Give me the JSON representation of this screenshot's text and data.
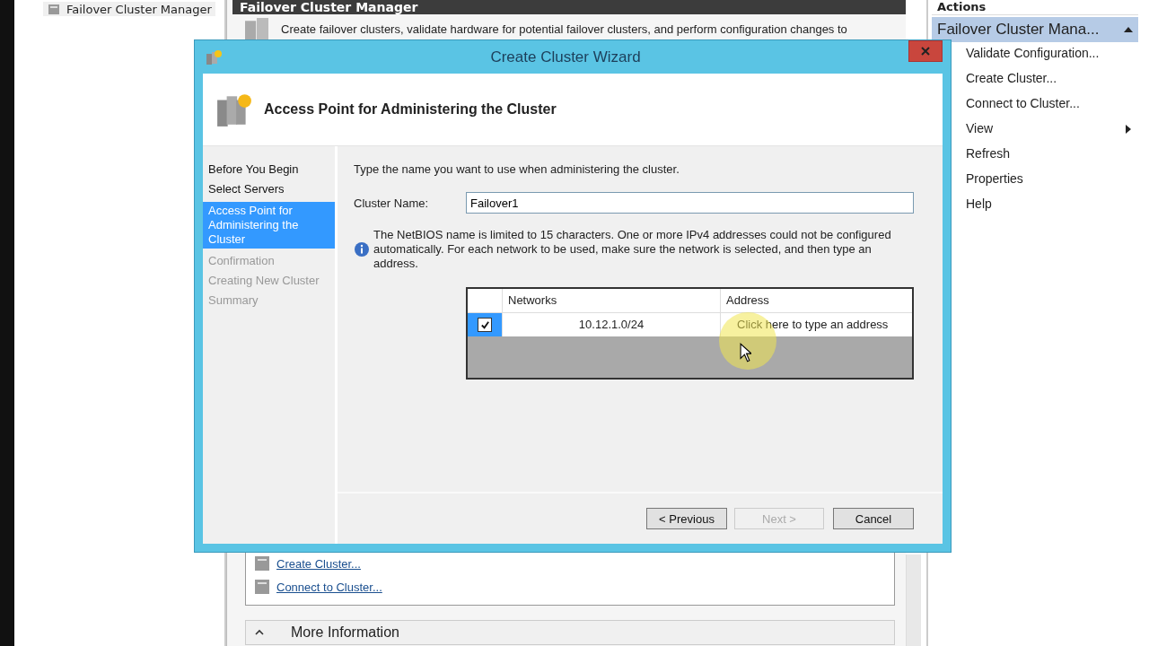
{
  "tree": {
    "root": "Failover Cluster Manager"
  },
  "center": {
    "header": "Failover Cluster Manager",
    "overview": "Create failover clusters, validate hardware for potential failover clusters, and perform configuration changes to",
    "links": [
      "Create Cluster...",
      "Connect to Cluster..."
    ],
    "section": "More Information"
  },
  "actions": {
    "header": "Actions",
    "group": "Failover Cluster Mana...",
    "items": [
      {
        "label": "Validate Configuration...",
        "submenu": false
      },
      {
        "label": "Create Cluster...",
        "submenu": false
      },
      {
        "label": "Connect to Cluster...",
        "submenu": false
      },
      {
        "label": "View",
        "submenu": true
      },
      {
        "label": "Refresh",
        "submenu": false
      },
      {
        "label": "Properties",
        "submenu": false
      },
      {
        "label": "Help",
        "submenu": false
      }
    ]
  },
  "wizard": {
    "title": "Create Cluster Wizard",
    "page_title": "Access Point for Administering the Cluster",
    "steps": [
      {
        "label": "Before You Begin",
        "selected": false,
        "disabled": false
      },
      {
        "label": "Select Servers",
        "selected": false,
        "disabled": false
      },
      {
        "label": "Access Point for Administering the Cluster",
        "selected": true,
        "disabled": false
      },
      {
        "label": "Confirmation",
        "selected": false,
        "disabled": true
      },
      {
        "label": "Creating New Cluster",
        "selected": false,
        "disabled": true
      },
      {
        "label": "Summary",
        "selected": false,
        "disabled": true
      }
    ],
    "instruction": "Type the name you want to use when administering the cluster.",
    "cluster_name_label": "Cluster Name:",
    "cluster_name": "Failover1",
    "info": "The NetBIOS name is limited to 15 characters.  One or more IPv4 addresses could not be configured automatically.  For each network to be used, make sure the network is selected, and then type an address.",
    "table": {
      "columns": [
        "Networks",
        "Address"
      ],
      "rows": [
        {
          "checked": true,
          "network": "10.12.1.0/24",
          "address_placeholder": "Click here to type an address"
        }
      ]
    },
    "buttons": [
      {
        "label": "< Previous",
        "disabled": false
      },
      {
        "label": "Next >",
        "disabled": true
      },
      {
        "label": "Cancel",
        "disabled": false
      }
    ]
  }
}
